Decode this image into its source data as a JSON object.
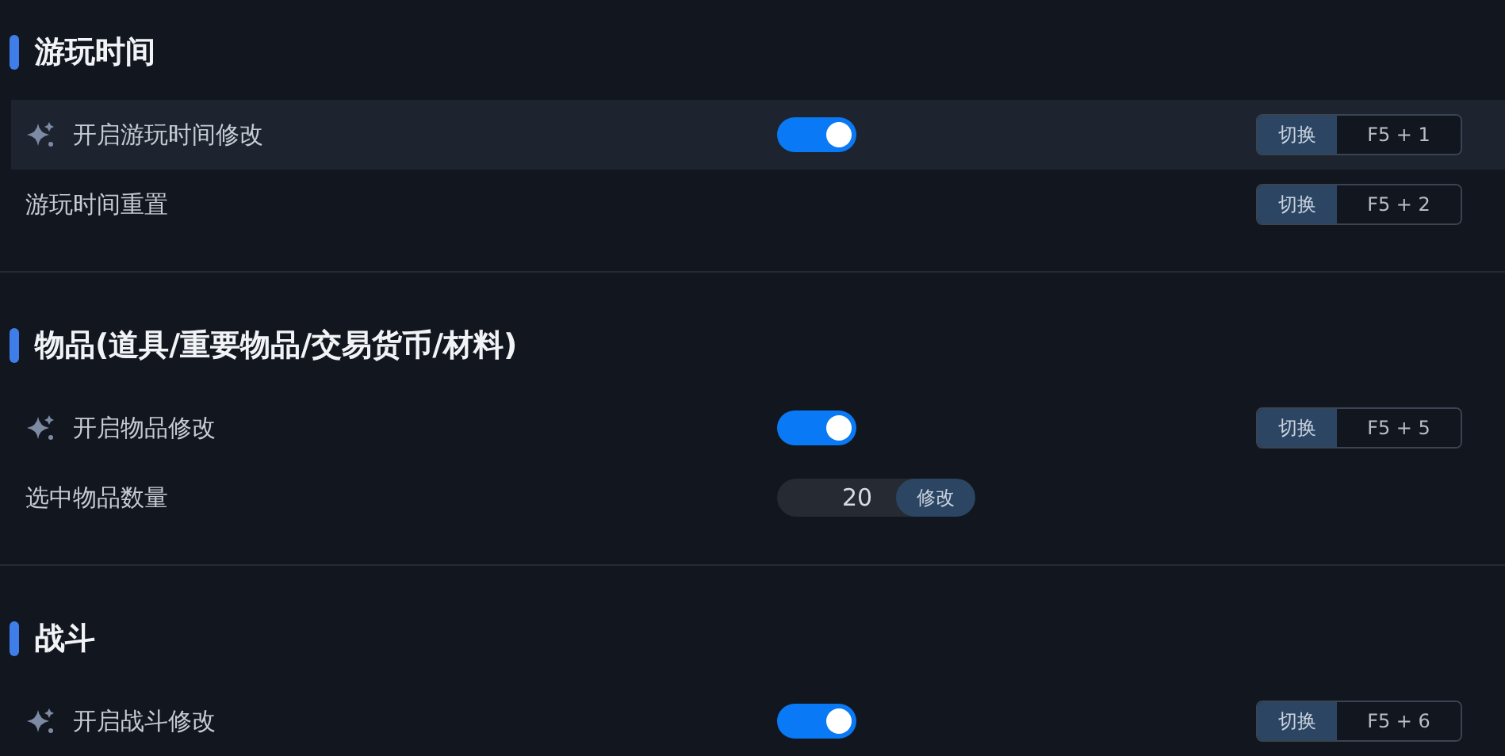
{
  "sections": [
    {
      "title": "游玩时间",
      "rows": [
        {
          "kind": "toggle",
          "label": "开启游玩时间修改",
          "highlighted": true,
          "on": true,
          "hotkey": {
            "action": "切换",
            "keys": "F5 + 1"
          }
        },
        {
          "kind": "button",
          "label": "游玩时间重置",
          "highlighted": false,
          "hotkey": {
            "action": "切换",
            "keys": "F5 + 2"
          }
        }
      ]
    },
    {
      "title": "物品(道具/重要物品/交易货币/材料)",
      "rows": [
        {
          "kind": "toggle",
          "label": "开启物品修改",
          "highlighted": false,
          "on": true,
          "hotkey": {
            "action": "切换",
            "keys": "F5 + 5"
          }
        },
        {
          "kind": "number",
          "label": "选中物品数量",
          "highlighted": false,
          "value": "20",
          "button": "修改"
        }
      ]
    },
    {
      "title": "战斗",
      "rows": [
        {
          "kind": "toggle",
          "label": "开启战斗修改",
          "highlighted": false,
          "on": true,
          "hotkey": {
            "action": "切换",
            "keys": "F5 + 6"
          }
        }
      ]
    }
  ]
}
